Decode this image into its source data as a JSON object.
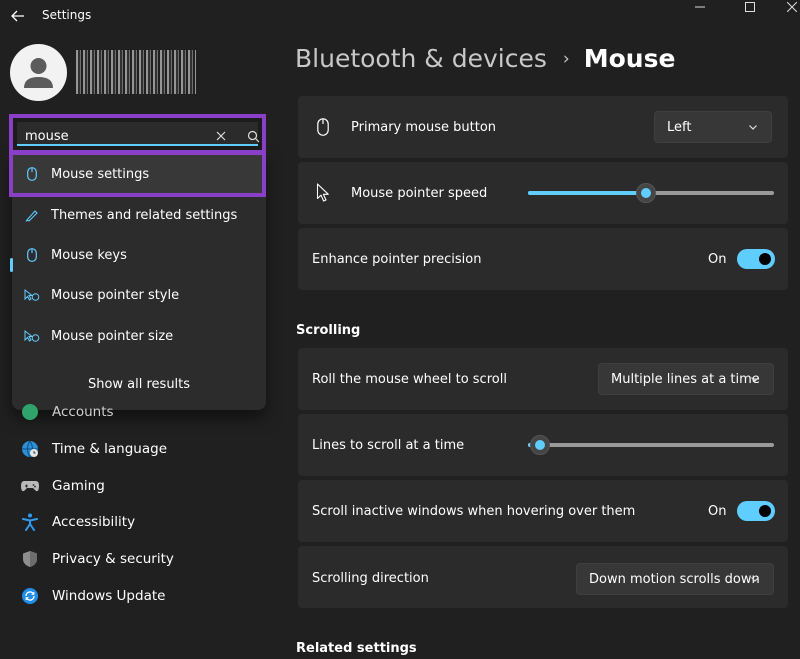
{
  "window": {
    "title": "Settings"
  },
  "search": {
    "value": "mouse"
  },
  "search_results": [
    {
      "label": "Mouse settings",
      "icon": "mouse-icon"
    },
    {
      "label": "Themes and related settings",
      "icon": "pen-icon"
    },
    {
      "label": "Mouse keys",
      "icon": "mouse-icon"
    },
    {
      "label": "Mouse pointer style",
      "icon": "pointer-icon"
    },
    {
      "label": "Mouse pointer size",
      "icon": "pointer-icon"
    }
  ],
  "show_all_label": "Show all results",
  "sidebar": {
    "items": [
      {
        "label": "Accounts",
        "icon": "accounts-icon"
      },
      {
        "label": "Time & language",
        "icon": "globe-icon"
      },
      {
        "label": "Gaming",
        "icon": "gamepad-icon"
      },
      {
        "label": "Accessibility",
        "icon": "accessibility-icon"
      },
      {
        "label": "Privacy & security",
        "icon": "shield-icon"
      },
      {
        "label": "Windows Update",
        "icon": "update-icon"
      }
    ]
  },
  "breadcrumb": {
    "parent": "Bluetooth & devices",
    "separator": "›",
    "current": "Mouse"
  },
  "settings": {
    "primary_button": {
      "label": "Primary mouse button",
      "value": "Left"
    },
    "pointer_speed": {
      "label": "Mouse pointer speed",
      "level": 0.48
    },
    "enhance_precision": {
      "label": "Enhance pointer precision",
      "state": "On"
    },
    "scrolling_title": "Scrolling",
    "roll_wheel": {
      "label": "Roll the mouse wheel to scroll",
      "value": "Multiple lines at a time"
    },
    "lines_to_scroll": {
      "label": "Lines to scroll at a time",
      "level": 0.05
    },
    "scroll_inactive": {
      "label": "Scroll inactive windows when hovering over them",
      "state": "On"
    },
    "scroll_direction": {
      "label": "Scrolling direction",
      "value": "Down motion scrolls down"
    },
    "related_title": "Related settings"
  },
  "colors": {
    "accent": "#60cdff",
    "highlight": "#8a3fc9",
    "background": "#202020",
    "card": "#2b2b2b"
  }
}
